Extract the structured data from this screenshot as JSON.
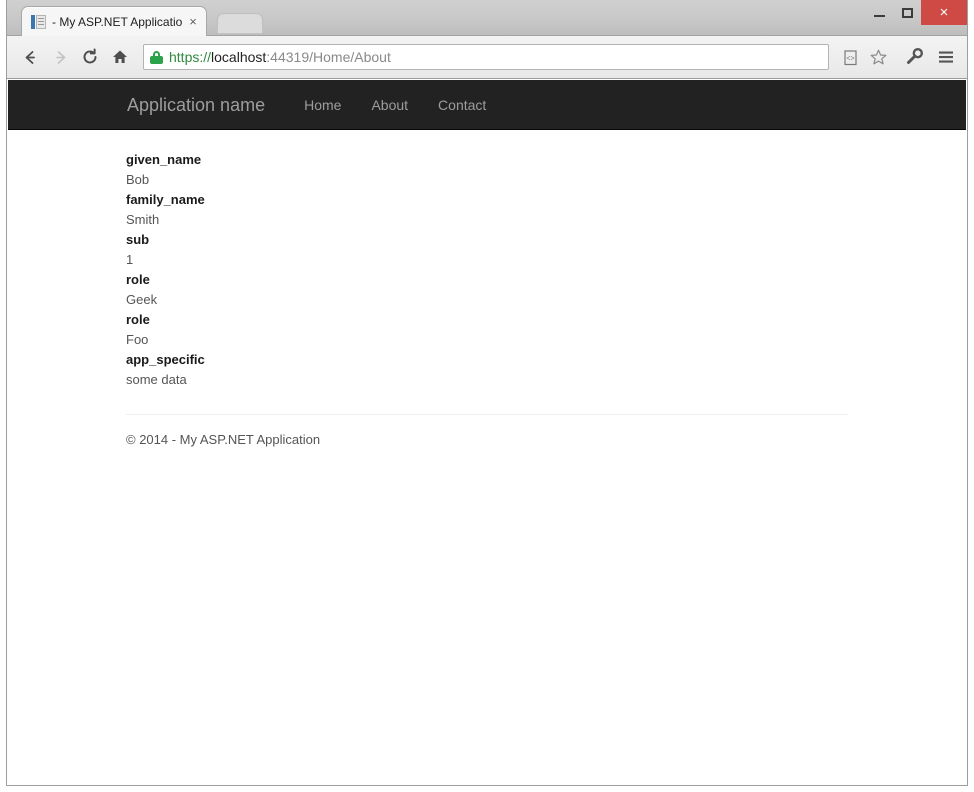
{
  "window": {
    "controls": {
      "minimize_label": "Minimize",
      "maximize_label": "Maximize",
      "close_label": "×"
    }
  },
  "tabstrip": {
    "tab": {
      "title": "- My ASP.NET Application",
      "favicon_name": "aspnet-page-icon",
      "close_label": "×"
    },
    "new_tab_label": ""
  },
  "toolbar": {
    "back_label": "←",
    "forward_label": "→",
    "reload_label": "↻",
    "home_label": "⌂",
    "omnibox": {
      "scheme": "https://",
      "host": "localhost",
      "rest": ":44319/Home/About",
      "full_url": "https://localhost:44319/Home/About",
      "security_icon": "lock-icon"
    },
    "icons": [
      {
        "name": "reading-list-icon",
        "glyph": "⎘"
      },
      {
        "name": "bookmark-star-icon",
        "glyph": "☆"
      },
      {
        "name": "key-icon",
        "glyph": "⚷"
      },
      {
        "name": "menu-icon",
        "glyph": "≡"
      }
    ]
  },
  "page": {
    "navbar": {
      "brand": "Application name",
      "links": [
        {
          "label": "Home"
        },
        {
          "label": "About"
        },
        {
          "label": "Contact"
        }
      ]
    },
    "claims": [
      {
        "term": "given_name",
        "value": "Bob"
      },
      {
        "term": "family_name",
        "value": "Smith"
      },
      {
        "term": "sub",
        "value": "1"
      },
      {
        "term": "role",
        "value": "Geek"
      },
      {
        "term": "role",
        "value": "Foo"
      },
      {
        "term": "app_specific",
        "value": "some data"
      }
    ],
    "footer": {
      "text": "© 2014 - My ASP.NET Application"
    }
  },
  "colors": {
    "navbar_bg": "#222222",
    "navbar_text": "#9d9d9d",
    "close_button_bg": "#cf4a44",
    "secure_green": "#2aa34a",
    "body_text": "#555555"
  }
}
